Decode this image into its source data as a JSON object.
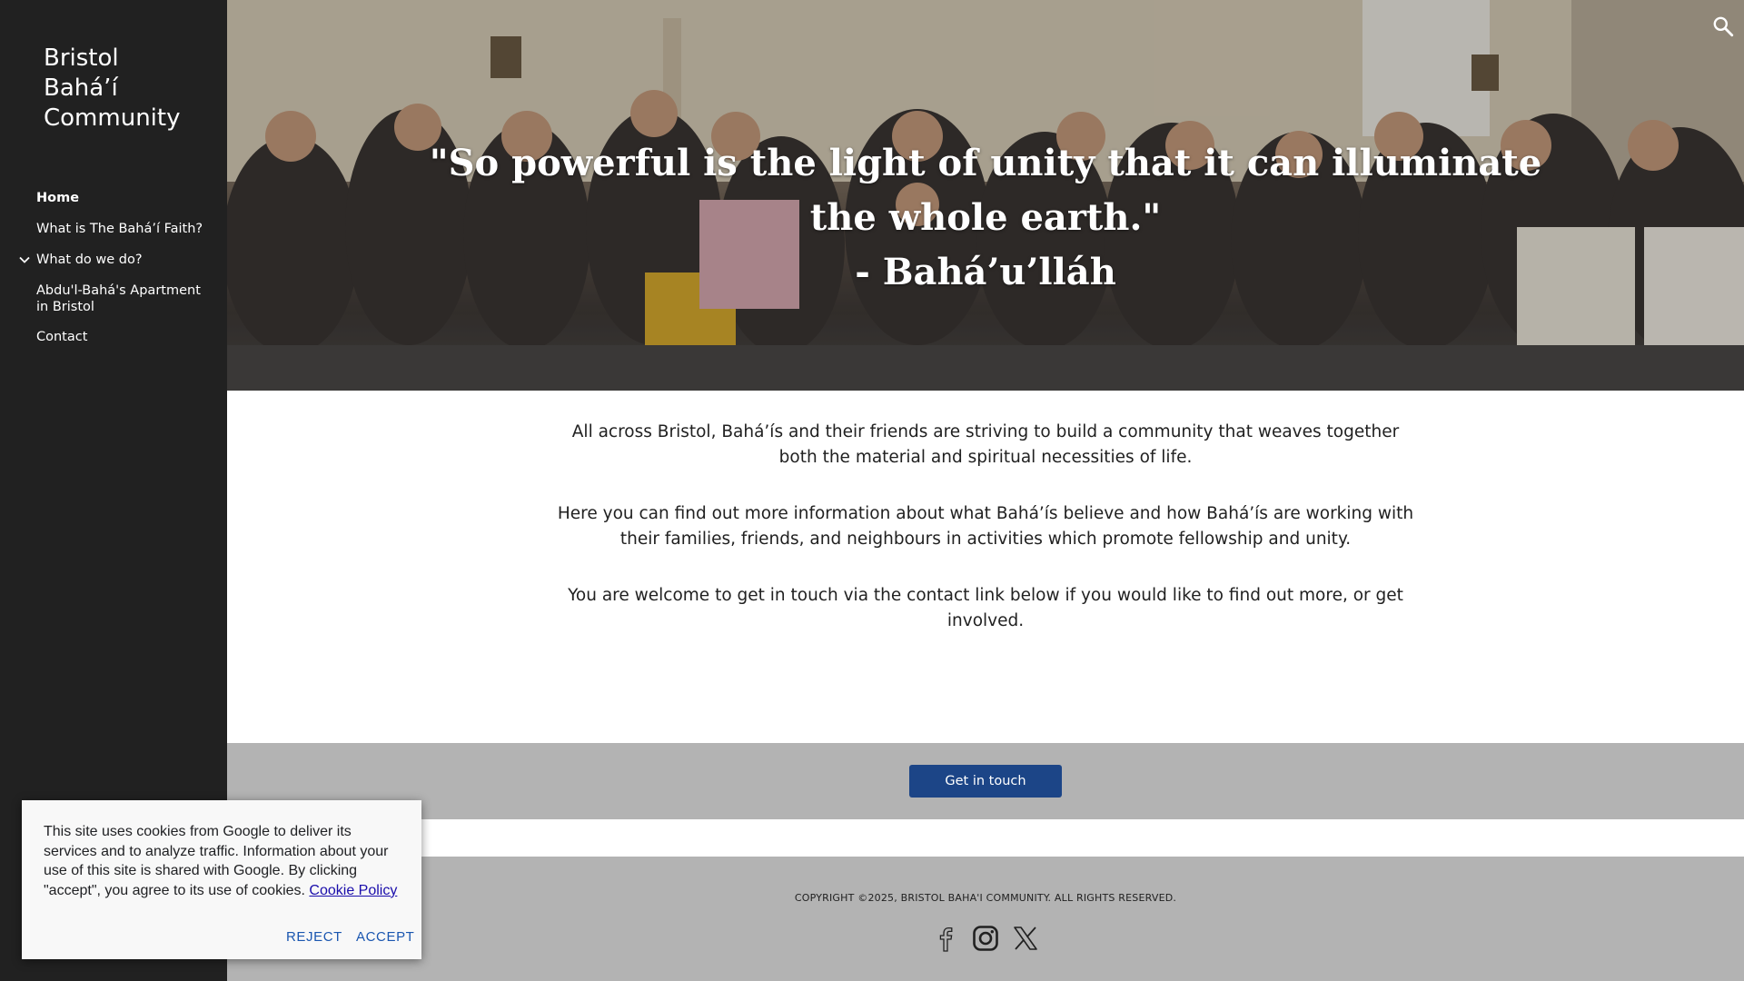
{
  "site": {
    "title_lines": [
      "Bristol",
      "Bahá’í",
      "Community"
    ]
  },
  "nav": {
    "items": [
      {
        "label": "Home",
        "active": true
      },
      {
        "label": "What is The Bahá’í Faith?"
      },
      {
        "label": "What do we do?",
        "expandable": true,
        "icon": "chevron-down-icon"
      },
      {
        "label": "Abdu'l-Bahá's Apartment in Bristol"
      },
      {
        "label": "Contact"
      }
    ]
  },
  "hero": {
    "quote_lines": [
      "\"So powerful is the light of unity that it can illuminate",
      "the whole earth.\""
    ],
    "attribution": "- Bahá’u’lláh",
    "search_icon": "search-icon"
  },
  "main": {
    "paragraphs": [
      "All across Bristol, Bahá’ís and their friends are striving to build a community that weaves together both the material and spiritual necessities of life.",
      "Here you can find out more information about what Bahá’ís believe and how Bahá’ís are working with their families, friends, and neighbours in activities which promote fellowship and unity.",
      "You are welcome to get in touch via the contact link below if you would like to find out more, or get involved."
    ],
    "cta_label": "Get in touch"
  },
  "footer": {
    "copyright": "COPYRIGHT ©2025, BRISTOL BAHA'I COMMUNITY. ALL RIGHTS RESERVED.",
    "social_icons": [
      "facebook-icon",
      "instagram-icon",
      "x-icon"
    ]
  },
  "cookie": {
    "text": "This site uses cookies from Google to deliver its services and to analyze traffic. Information about your use of this site is shared with Google. By clicking \"accept\", you agree to its use of cookies.",
    "policy_link": "Cookie Policy",
    "reject_label": "REJECT",
    "accept_label": "ACCEPT"
  },
  "colors": {
    "sidebar_bg": "#212121",
    "cta_bg": "#1c4587",
    "band_bg": "#b3b3b3",
    "cookie_button": "#1a56b0"
  }
}
